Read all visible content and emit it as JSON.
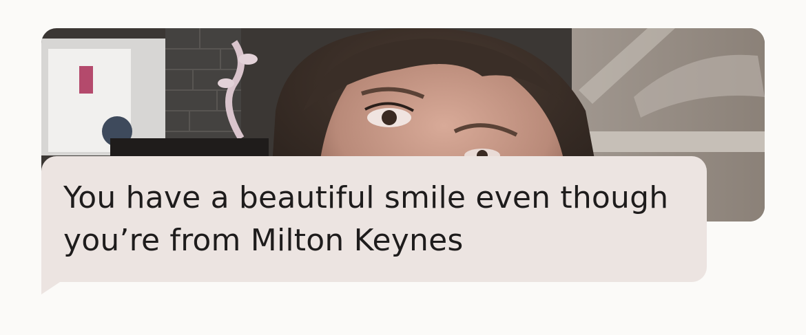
{
  "photo": {
    "description_icon": "profile-photo"
  },
  "comment": {
    "text": "You have a beautiful smile even though\nyou’re from Milton Keynes"
  },
  "colors": {
    "page_background": "#fbfaf8",
    "bubble_background": "#ece4e1",
    "text": "#1e1c1c"
  }
}
